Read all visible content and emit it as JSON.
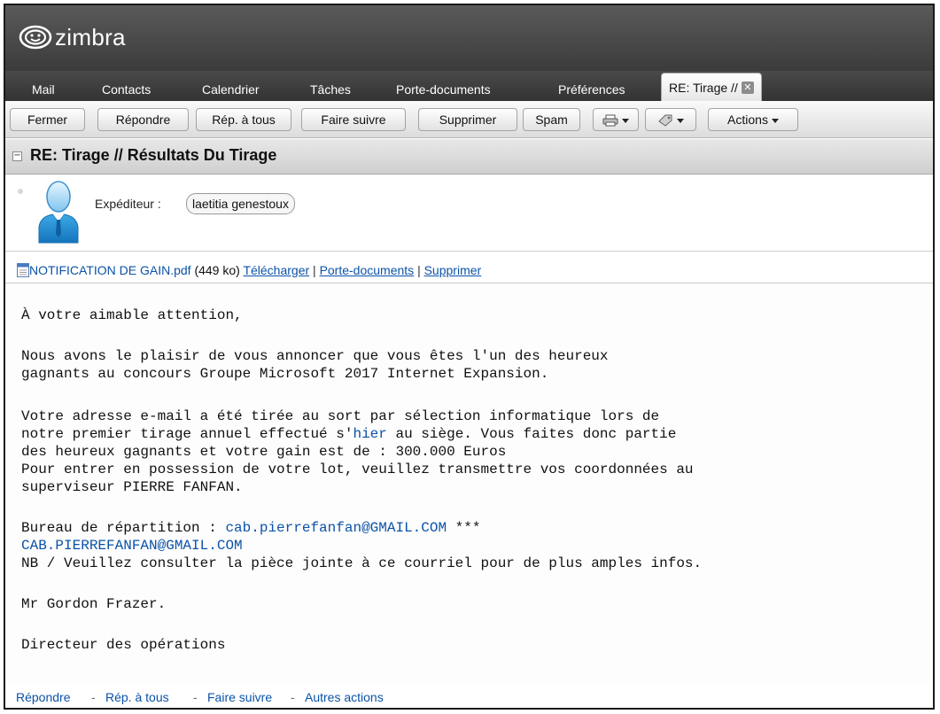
{
  "app": {
    "logo_text": "zimbra"
  },
  "tabs": [
    "Mail",
    "Contacts",
    "Calendrier",
    "Tâches",
    "Porte-documents",
    "Préférences"
  ],
  "active_tab": {
    "label": "RE: Tirage //",
    "close_icon": "close-icon"
  },
  "toolbar": {
    "close": "Fermer",
    "reply": "Répondre",
    "reply_all": "Rép. à tous",
    "forward": "Faire suivre",
    "delete": "Supprimer",
    "spam": "Spam",
    "print_icon": "print-icon",
    "tag_icon": "tag-icon",
    "actions": "Actions"
  },
  "message": {
    "subject": "RE: Tirage // Résultats Du Tirage",
    "from_label": "Expéditeur :",
    "from_name": "laetitia genestoux"
  },
  "attachment": {
    "name": "NOTIFICATION DE GAIN.pdf",
    "size": "(449 ko)",
    "download": "Télécharger",
    "briefcase": "Porte-documents",
    "delete": "Supprimer",
    "separator": "|"
  },
  "body": {
    "l1": "À votre aimable attention,",
    "l2": "Nous avons le plaisir de vous annoncer que vous êtes l'un des heureux",
    "l3": "gagnants au concours Groupe Microsoft 2017 Internet Expansion.",
    "l4": "Votre adresse e-mail a été tirée au sort par sélection informatique lors de",
    "l5_pre": "notre premier tirage annuel effectué s'",
    "l5_link": "hier",
    "l5_post": " au siège. Vous faites donc partie",
    "l6": "des heureux gagnants et votre gain est de : 300.000 Euros",
    "l7": "Pour entrer en possession de votre lot, veuillez transmettre vos coordonnées au",
    "l8": "superviseur PIERRE FANFAN.",
    "l9_pre": "Bureau de répartition : ",
    "l9_email": "cab.pierrefanfan@GMAIL.COM",
    "l9_post": " ***",
    "l10_email": "CAB.PIERREFANFAN@GMAIL.COM",
    "l11": "NB / Veuillez consulter la pièce jointe à ce courriel pour de plus amples infos.",
    "l12": "Mr Gordon Frazer.",
    "l13": "Directeur des opérations"
  },
  "footer": {
    "reply": "Répondre",
    "reply_all": "Rép. à tous",
    "forward": "Faire suivre",
    "more": "Autres actions",
    "sep": "-"
  }
}
